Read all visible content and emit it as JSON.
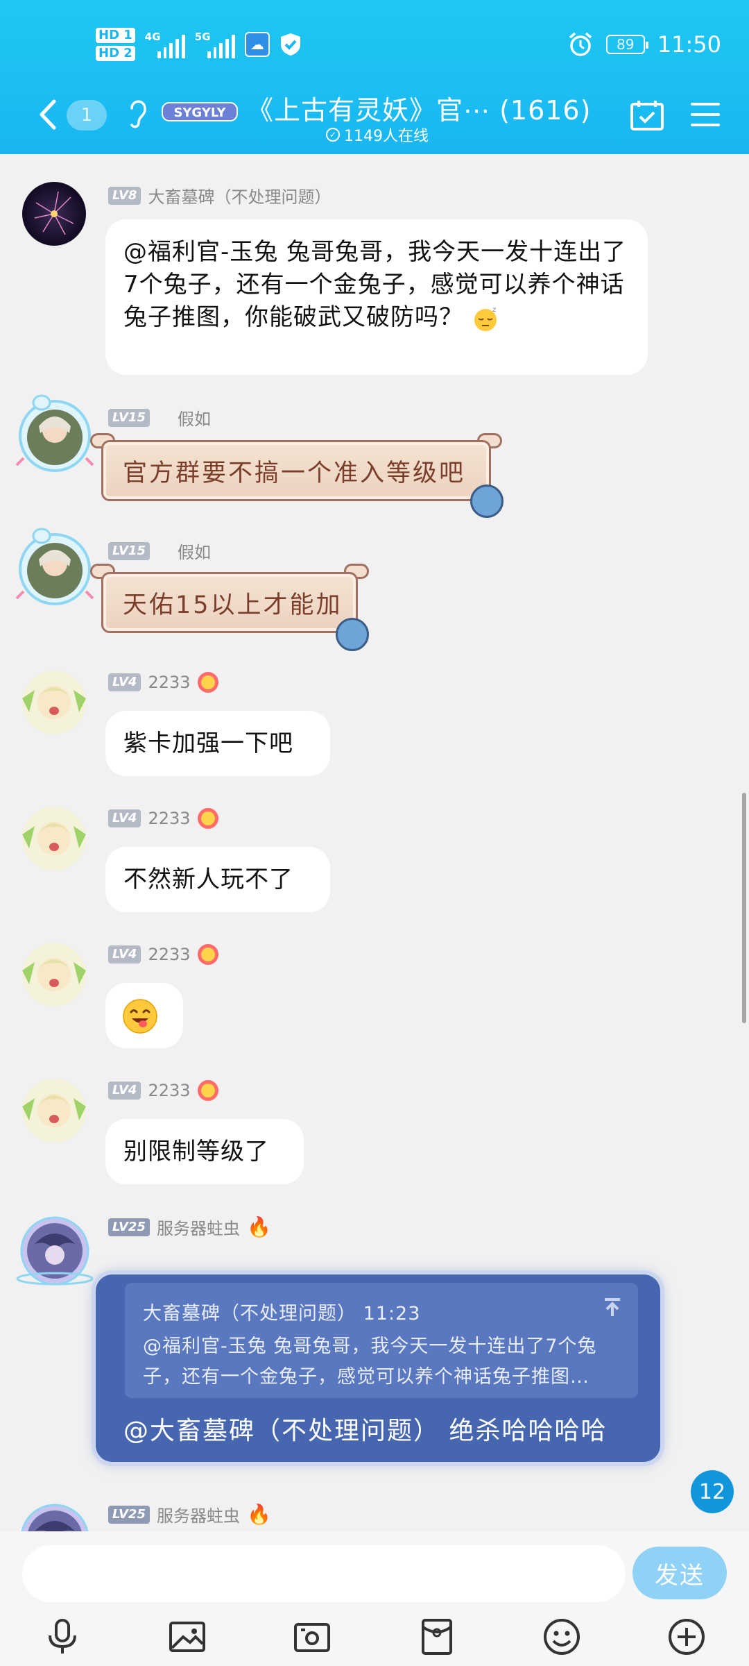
{
  "status_bar": {
    "hd1": "HD 1",
    "hd2": "HD 2",
    "net1": "4G",
    "net2": "5G",
    "battery": "89",
    "time": "11:50"
  },
  "header": {
    "unread_count": "1",
    "title": "《上古有灵妖》官⋯ (1616)",
    "online": "1149人在线",
    "logo_text": "SYGYLY"
  },
  "messages": [
    {
      "level": "LV8",
      "name": "大畜墓碑（不处理问题）",
      "text": "@福利官-玉兔  兔哥兔哥，我今天一发十连出了7个兔子，还有一个金兔子，感觉可以养个神话兔子推图，你能破武又破防吗？",
      "emoji": "sleepy-face"
    },
    {
      "level": "LV15",
      "name": "假如",
      "text": "官方群要不搞一个准入等级吧"
    },
    {
      "level": "LV15",
      "name": "假如",
      "text": "天佑15以上才能加"
    },
    {
      "level": "LV4",
      "name": "2233",
      "text": "紫卡加强一下吧"
    },
    {
      "level": "LV4",
      "name": "2233",
      "text": "不然新人玩不了"
    },
    {
      "level": "LV4",
      "name": "2233",
      "text": "",
      "emoji": "yum-face"
    },
    {
      "level": "LV4",
      "name": "2233",
      "text": "别限制等级了"
    },
    {
      "level": "LV25",
      "name": "服务器蛀虫",
      "quote_header": "大畜墓碑（不处理问题）  11:23",
      "quote_text": "@福利官-玉兔  兔哥兔哥，我今天一发十连出了7个兔子，还有一个金兔子，感觉可以养个神话兔子推图…",
      "text": "@大畜墓碑（不处理问题）  绝杀哈哈哈哈"
    },
    {
      "level": "LV25",
      "name": "服务器蛀虫"
    }
  ],
  "new_messages_badge": "12",
  "composer": {
    "placeholder": "",
    "send_label": "发送"
  },
  "toolbar_icons": [
    "microphone-icon",
    "image-icon",
    "camera-icon",
    "red-packet-icon",
    "emoji-icon",
    "plus-icon"
  ],
  "colors": {
    "header": "#19b6f1",
    "accent": "#1296db",
    "send_button": "#8fd2f6",
    "reply_card": "#4666b0"
  }
}
